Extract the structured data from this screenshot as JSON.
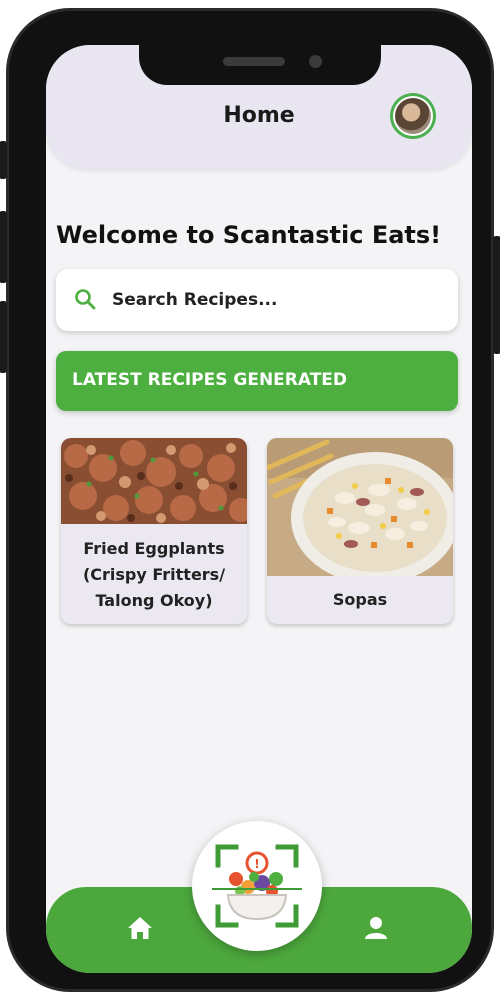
{
  "header": {
    "title": "Home",
    "avatar_icon": "user-avatar"
  },
  "welcome_text": "Welcome to Scantastic Eats!",
  "search": {
    "placeholder": "Search Recipes...",
    "icon": "search-icon"
  },
  "latest_section": {
    "title": "LATEST RECIPES GENERATED"
  },
  "recipes": [
    {
      "title": "Fried Eggplants (Crispy Fritters/ Talong Okoy)"
    },
    {
      "title": "Sopas"
    }
  ],
  "bottom_nav": {
    "items": [
      {
        "icon": "home-icon"
      },
      {
        "icon": "scan-food-icon"
      },
      {
        "icon": "profile-icon"
      }
    ]
  },
  "colors": {
    "accent_green": "#4caf3f",
    "header_bg": "#e9e6f2",
    "screen_bg": "#f4f4f6",
    "card_bg": "#ebe8f2"
  }
}
